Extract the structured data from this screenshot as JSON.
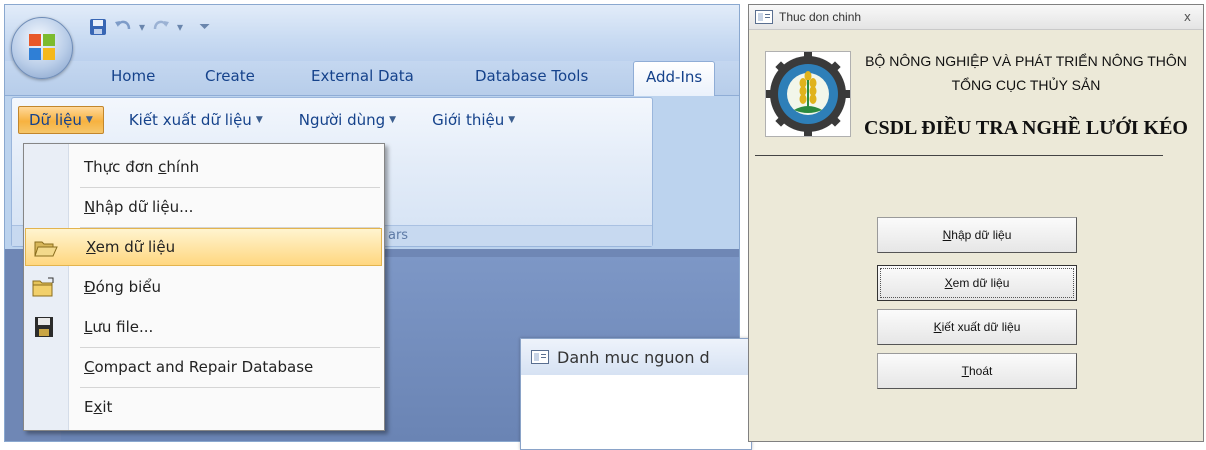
{
  "access": {
    "tabs": [
      "Home",
      "Create",
      "External Data",
      "Database Tools",
      "Add-Ins"
    ],
    "active_tab": "Add-Ins",
    "ribbon_buttons": [
      "Dữ liệu",
      "Kiết xuất dữ liệu",
      "Người dùng",
      "Giới thiệu"
    ],
    "active_ribbon_button": "Dữ liệu",
    "group_label_fragment": "ars",
    "menu": {
      "items": [
        {
          "pre": "Thực đơn ",
          "acc": "c",
          "post": "hính",
          "icon": ""
        },
        {
          "pre": "",
          "acc": "N",
          "post": "hập dữ liệu...",
          "icon": ""
        },
        {
          "pre": "",
          "acc": "X",
          "post": "em dữ liệu",
          "icon": "open-folder-icon",
          "highlighted": true
        },
        {
          "pre": "",
          "acc": "Đ",
          "post": "óng biểu",
          "icon": "close-folder-icon"
        },
        {
          "pre": "",
          "acc": "L",
          "post": "ưu file...",
          "icon": "save-disk-icon"
        },
        {
          "pre": "",
          "acc": "C",
          "post": "ompact and Repair Database",
          "icon": ""
        },
        {
          "pre": "E",
          "acc": "x",
          "post": "it",
          "icon": ""
        }
      ]
    },
    "subwindow_title": "Danh muc nguon d"
  },
  "dialog": {
    "title": "Thuc don chinh",
    "close": "x",
    "org_line1": "BỘ NÔNG NGHIỆP VÀ PHÁT TRIỂN NÔNG THÔN",
    "org_line2": "TỔNG CỤC THỦY SẢN",
    "system_title": "CSDL ĐIỀU TRA NGHỀ LƯỚI KÉO",
    "buttons": [
      {
        "acc": "N",
        "rest": "hập dữ liệu"
      },
      {
        "acc": "X",
        "rest": "em dữ liệu",
        "focused": true
      },
      {
        "acc": "K",
        "rest": "iết xuất dữ liệu"
      },
      {
        "acc": "T",
        "rest": "hoát"
      }
    ]
  },
  "colors": {
    "ribbon_accent": "#f7b240",
    "menu_highlight": "#ffd780",
    "dialog_background": "#ece9d8",
    "tab_text": "#15428b"
  }
}
